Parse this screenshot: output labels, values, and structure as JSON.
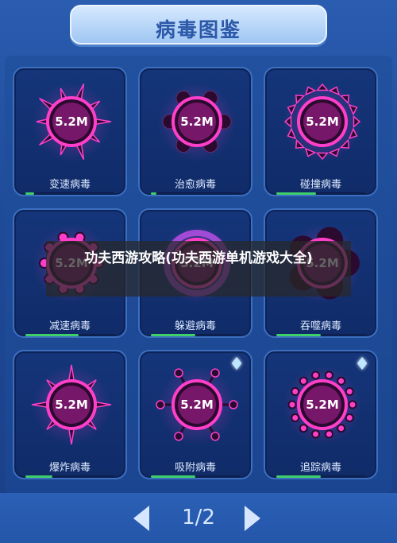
{
  "header": {
    "title": "病毒图鉴"
  },
  "cards": [
    {
      "name": "变速病毒",
      "value": "5.2M",
      "progress": 0.1,
      "style": "spike",
      "gem": false
    },
    {
      "name": "治愈病毒",
      "value": "5.2M",
      "progress": 0.06,
      "style": "hex",
      "gem": false
    },
    {
      "name": "碰撞病毒",
      "value": "5.2M",
      "progress": 0.45,
      "style": "saw",
      "gem": false
    },
    {
      "name": "减速病毒",
      "value": "5.2M",
      "progress": 0.6,
      "style": "dots",
      "gem": false
    },
    {
      "name": "躲避病毒",
      "value": "5.2M",
      "progress": 0.5,
      "style": "ring",
      "gem": false
    },
    {
      "name": "吞噬病毒",
      "value": "5.2M",
      "progress": 0.5,
      "style": "lobes",
      "gem": false
    },
    {
      "name": "爆炸病毒",
      "value": "5.2M",
      "progress": 0.3,
      "style": "star",
      "gem": false
    },
    {
      "name": "吸附病毒",
      "value": "5.2M",
      "progress": 0.5,
      "style": "pins",
      "gem": true
    },
    {
      "name": "追踪病毒",
      "value": "5.2M",
      "progress": 0.5,
      "style": "beads",
      "gem": true
    }
  ],
  "pager": {
    "label": "1/2"
  },
  "overlay": {
    "text": "功夫西游攻略(功夫西游单机游戏大全)"
  },
  "colors": {
    "virus": "#ff3fc9",
    "virus_dark": "#2a0a2e",
    "progress": "#3fd06a"
  },
  "icons": {
    "prev": "left-arrow-icon",
    "next": "right-arrow-icon",
    "gem": "diamond-icon"
  }
}
